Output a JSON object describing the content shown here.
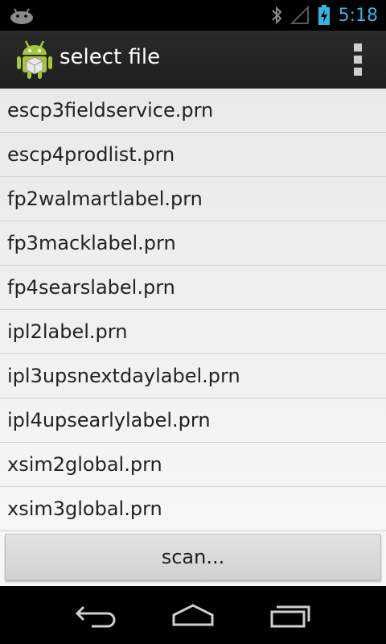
{
  "status_bar": {
    "time": "5:18",
    "icons": [
      "android-notification-icon",
      "bluetooth-icon",
      "signal-icon",
      "battery-charging-icon"
    ]
  },
  "action_bar": {
    "title": "select file",
    "app_icon": "android-app-icon",
    "overflow_icon": "overflow-menu-icon"
  },
  "files": [
    "escp3fieldservice.prn",
    "escp4prodlist.prn",
    "fp2walmartlabel.prn",
    "fp3macklabel.prn",
    "fp4searslabel.prn",
    "ipl2label.prn",
    "ipl3upsnextdaylabel.prn",
    "ipl4upsearlylabel.prn",
    "xsim2global.prn",
    "xsim3global.prn"
  ],
  "scan_button_label": "scan...",
  "nav_bar": {
    "icons": [
      "back-icon",
      "home-icon",
      "recent-apps-icon"
    ]
  },
  "colors": {
    "status_accent": "#33b5e5",
    "action_bar": "#262626",
    "list_background": "#f0f0f0"
  }
}
